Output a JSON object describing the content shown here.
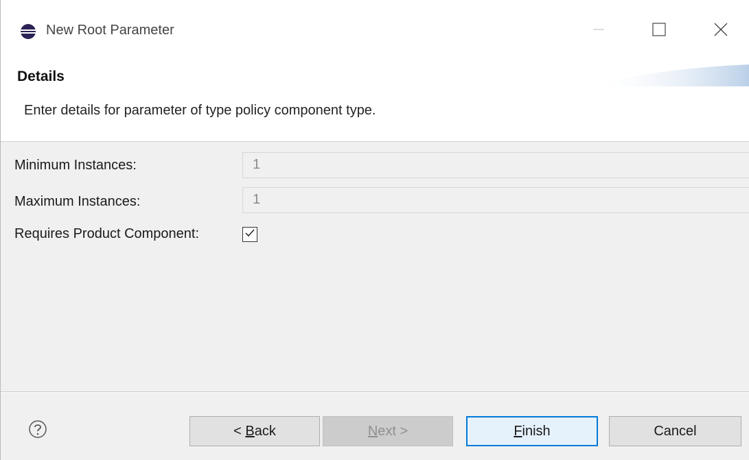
{
  "window": {
    "title": "New Root Parameter",
    "icon": "eclipse-icon",
    "controls": {
      "minimize": "minimize-icon",
      "maximize": "maximize-icon",
      "close": "close-icon"
    }
  },
  "header": {
    "title": "Details",
    "description": "Enter details for parameter of type policy component type."
  },
  "form": {
    "min_instances": {
      "label": "Minimum Instances:",
      "value": "1"
    },
    "max_instances": {
      "label": "Maximum Instances:",
      "value": "1"
    },
    "requires_product_component": {
      "label": "Requires Product Component:",
      "checked": true
    }
  },
  "footer": {
    "help_icon": "help-icon",
    "back": {
      "prefix": "< ",
      "mnemonic": "B",
      "rest": "ack"
    },
    "next": {
      "mnemonic": "N",
      "rest": "ext >"
    },
    "finish": {
      "mnemonic": "F",
      "rest": "inish"
    },
    "cancel": {
      "label": "Cancel"
    }
  },
  "colors": {
    "accent": "#0078d7",
    "window_bg": "#f0f0f0",
    "header_bg": "#ffffff"
  }
}
